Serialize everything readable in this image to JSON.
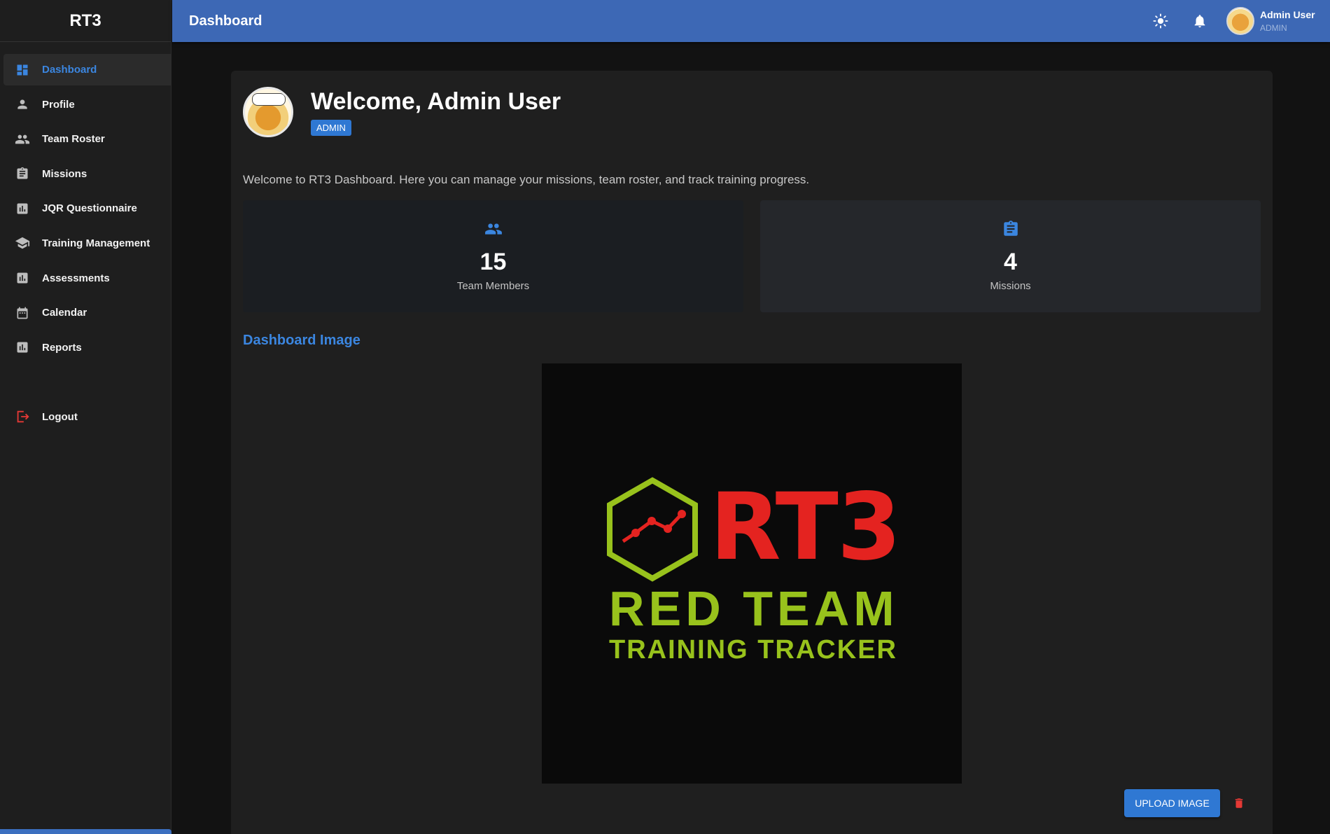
{
  "app": {
    "brand": "RT3"
  },
  "header": {
    "title": "Dashboard",
    "user_name": "Admin User",
    "user_role": "ADMIN",
    "icons": [
      "theme-toggle-icon",
      "notifications-icon"
    ]
  },
  "sidebar": {
    "items": [
      {
        "label": "Dashboard",
        "icon": "dashboard-icon",
        "active": true
      },
      {
        "label": "Profile",
        "icon": "person-icon"
      },
      {
        "label": "Team Roster",
        "icon": "people-icon"
      },
      {
        "label": "Missions",
        "icon": "clipboard-icon"
      },
      {
        "label": "JQR Questionnaire",
        "icon": "bar-chart-icon"
      },
      {
        "label": "Training Management",
        "icon": "school-icon"
      },
      {
        "label": "Assessments",
        "icon": "bar-chart-icon"
      },
      {
        "label": "Calendar",
        "icon": "calendar-icon"
      },
      {
        "label": "Reports",
        "icon": "bar-chart-icon"
      }
    ],
    "logout": "Logout"
  },
  "main": {
    "welcome": "Welcome, Admin User",
    "role_badge": "ADMIN",
    "intro": "Welcome to RT3 Dashboard. Here you can manage your missions, team roster, and track training progress.",
    "stats": [
      {
        "value": "15",
        "label": "Team Members",
        "icon": "people-icon"
      },
      {
        "value": "4",
        "label": "Missions",
        "icon": "clipboard-icon"
      }
    ],
    "image_section_title": "Dashboard Image",
    "logo": {
      "main": "RT3",
      "line1": "RED TEAM",
      "line2": "TRAINING TRACKER"
    },
    "upload_label": "UPLOAD IMAGE",
    "delete_icon": "trash-icon"
  },
  "colors": {
    "accent": "#3b86e0",
    "topbar": "#3d68b5",
    "logo_red": "#e42320",
    "logo_green": "#98c21c",
    "danger": "#e53935"
  }
}
